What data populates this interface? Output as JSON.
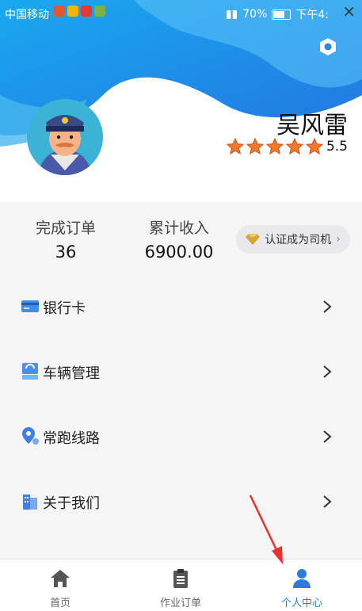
{
  "status_bar": {
    "carrier": "中国移动",
    "battery": "70%",
    "time": "下午4:"
  },
  "window": {
    "close_symbol": "×"
  },
  "profile": {
    "name": "吴风雷",
    "rating": "5.5",
    "stars": 5
  },
  "stats": {
    "orders_label": "完成订单",
    "orders_value": "36",
    "income_label": "累计收入",
    "income_value": "6900.00",
    "certify_label": "认证成为司机",
    "certify_chevron": "›"
  },
  "menu": {
    "items": [
      {
        "label": "银行卡",
        "icon": "bank-card-icon"
      },
      {
        "label": "车辆管理",
        "icon": "vehicle-icon"
      },
      {
        "label": "常跑线路",
        "icon": "route-icon"
      },
      {
        "label": "关于我们",
        "icon": "building-icon"
      }
    ]
  },
  "tabbar": {
    "tabs": [
      {
        "label": "首页",
        "icon": "home-icon"
      },
      {
        "label": "作业订单",
        "icon": "clipboard-icon"
      },
      {
        "label": "个人中心",
        "icon": "person-icon",
        "active": true
      }
    ]
  },
  "colors": {
    "header_blue": "#1e8fe6",
    "accent_blue": "#2d7bd8",
    "star_orange": "#f07a2a",
    "annotation_red": "#e8322e"
  }
}
